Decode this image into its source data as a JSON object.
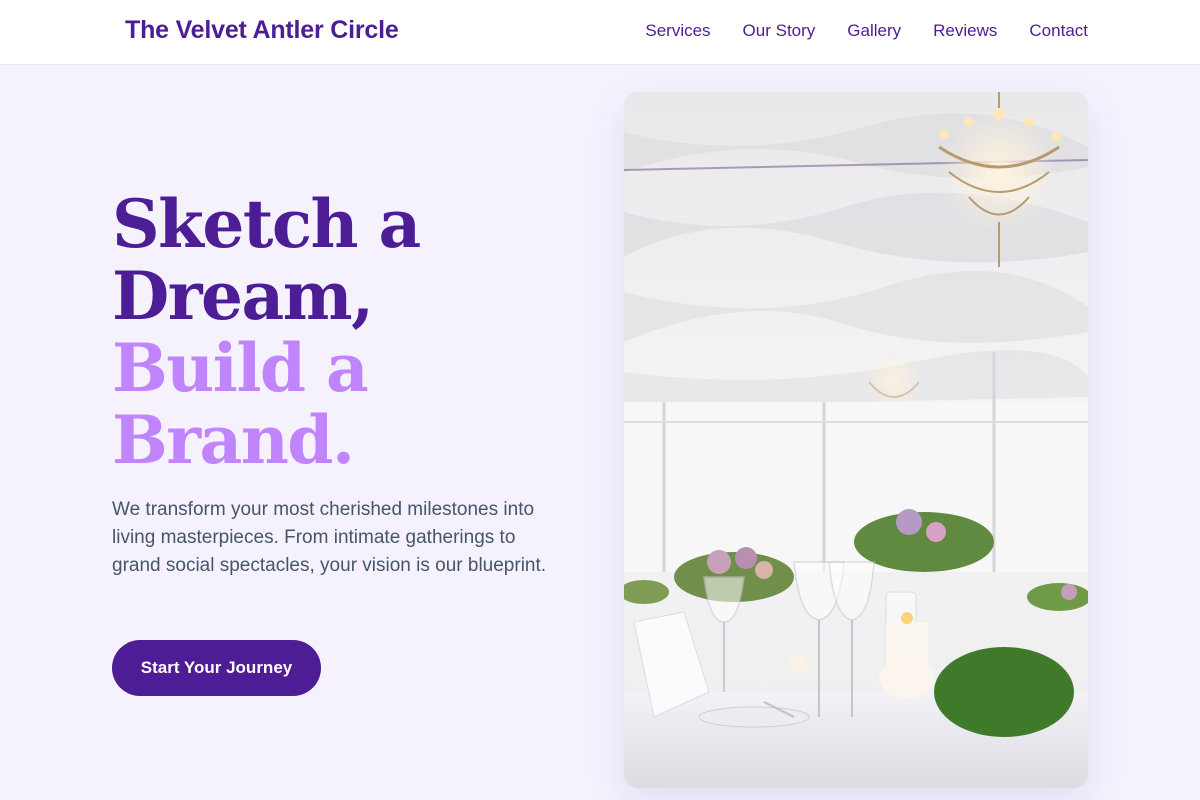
{
  "header": {
    "brand": "The Velvet Antler Circle",
    "nav": [
      "Services",
      "Our Story",
      "Gallery",
      "Reviews",
      "Contact"
    ]
  },
  "hero": {
    "title_dark_1": "Sketch a",
    "title_dark_2": "Dream,",
    "title_light_1": "Build a",
    "title_light_2": "Brand.",
    "subtitle": "We transform your most cherished milestones into living masterpieces. From intimate gatherings to grand social spectacles, your vision is our blueprint.",
    "cta": "Start Your Journey"
  },
  "colors": {
    "primary": "#4c1d95",
    "accent": "#c084fc",
    "background": "#f5f2fe",
    "body_text": "#475569"
  }
}
